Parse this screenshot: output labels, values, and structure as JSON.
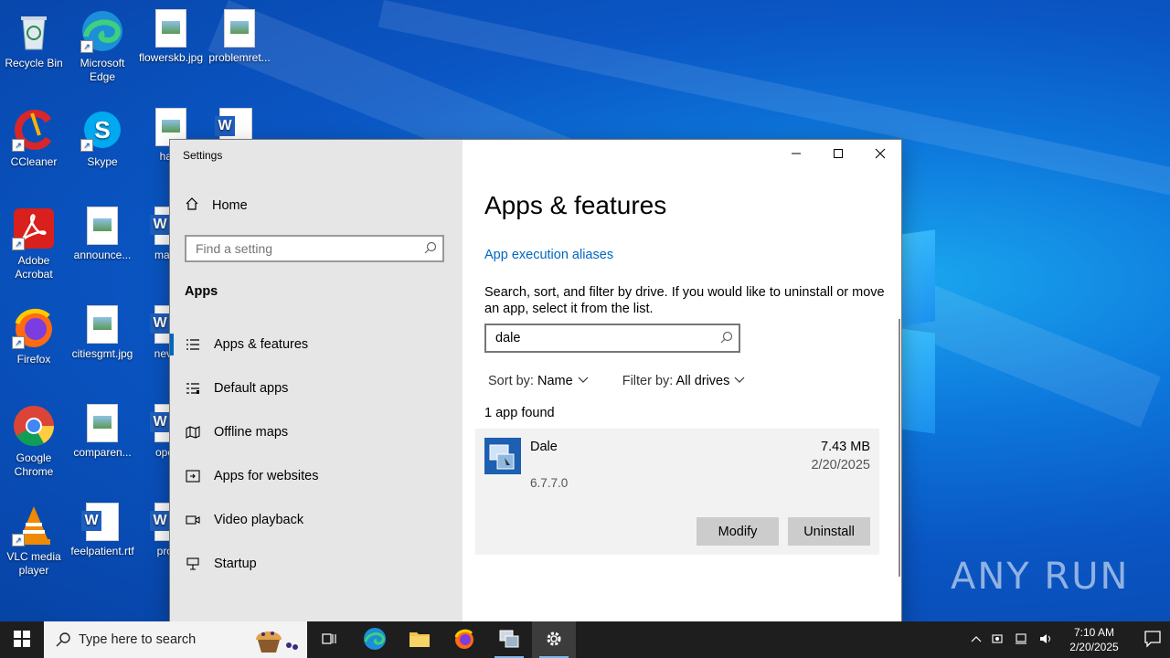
{
  "desktop": {
    "icons": [
      {
        "label": "Recycle Bin"
      },
      {
        "label": "Microsoft Edge"
      },
      {
        "label": "flowerskb.jpg"
      },
      {
        "label": "problemret..."
      },
      {
        "label": "CCleaner"
      },
      {
        "label": "Skype"
      },
      {
        "label": "hallc"
      },
      {
        "label": "Adobe Acrobat"
      },
      {
        "label": "announce..."
      },
      {
        "label": "magaz"
      },
      {
        "label": "Firefox"
      },
      {
        "label": "citiesgmt.jpg"
      },
      {
        "label": "neverp"
      },
      {
        "label": "Google Chrome"
      },
      {
        "label": "comparen..."
      },
      {
        "label": "operat"
      },
      {
        "label": "VLC media player"
      },
      {
        "label": "feelpatient.rtf"
      },
      {
        "label": "proba"
      }
    ],
    "watermark": "ANY RUN"
  },
  "settings": {
    "window_title": "Settings",
    "sidebar": {
      "home_label": "Home",
      "search_placeholder": "Find a setting",
      "section_label": "Apps",
      "items": [
        {
          "label": "Apps & features",
          "icon": "list-icon",
          "active": true
        },
        {
          "label": "Default apps",
          "icon": "default-apps-icon"
        },
        {
          "label": "Offline maps",
          "icon": "map-icon"
        },
        {
          "label": "Apps for websites",
          "icon": "web-app-icon"
        },
        {
          "label": "Video playback",
          "icon": "video-icon"
        },
        {
          "label": "Startup",
          "icon": "startup-icon"
        }
      ]
    },
    "content": {
      "title": "Apps & features",
      "alias_link": "App execution aliases",
      "description": "Search, sort, and filter by drive. If you would like to uninstall or move an app, select it from the list.",
      "search_value": "dale",
      "sort_label": "Sort by:",
      "sort_value": "Name",
      "filter_label": "Filter by:",
      "filter_value": "All drives",
      "found_text": "1 app found",
      "app": {
        "name": "Dale",
        "version": "6.7.7.0",
        "size": "7.43 MB",
        "date": "2/20/2025",
        "modify_label": "Modify",
        "uninstall_label": "Uninstall"
      }
    }
  },
  "taskbar": {
    "search_placeholder": "Type here to search",
    "time": "7:10 AM",
    "date": "2/20/2025"
  },
  "colors": {
    "accent": "#0067c0",
    "sidebar_bg": "#e6e6e6",
    "taskbar_bg": "#1e1e1e"
  }
}
